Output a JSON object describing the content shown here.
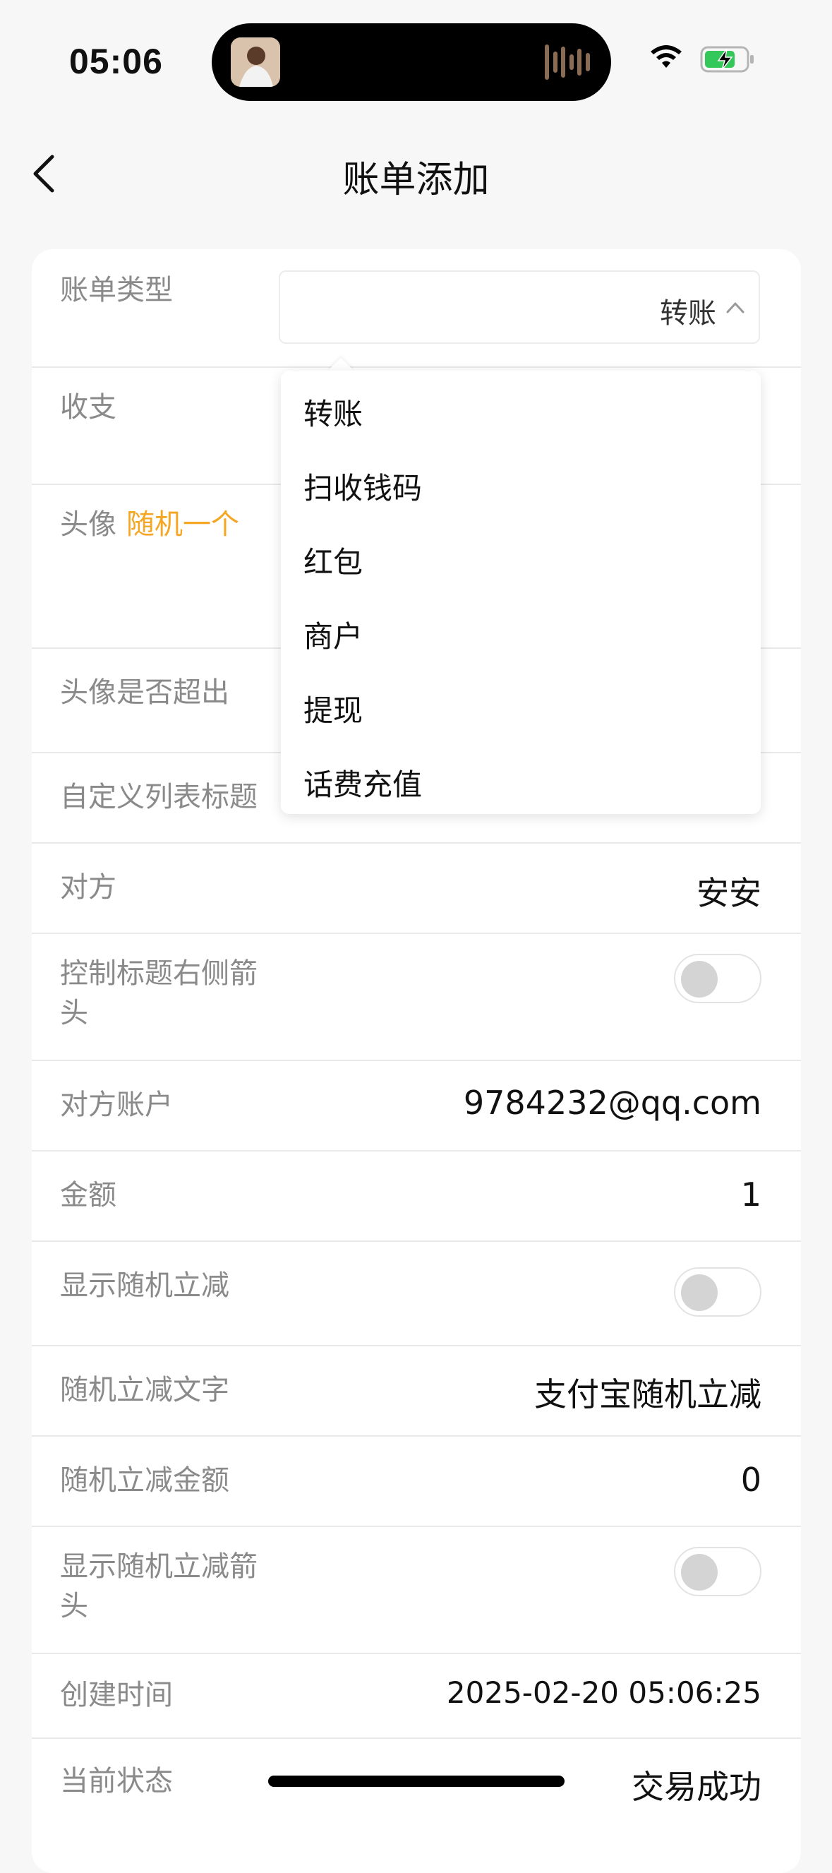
{
  "status": {
    "time": "05:06"
  },
  "nav": {
    "title": "账单添加"
  },
  "form": {
    "bill_type": {
      "label": "账单类型",
      "value": "转账"
    },
    "income_expense": {
      "label": "收支"
    },
    "avatar": {
      "label": "头像",
      "random_link": "随机一个"
    },
    "avatar_overflow": {
      "label": "头像是否超出"
    },
    "custom_list_title": {
      "label": "自定义列表标题"
    },
    "counterparty": {
      "label": "对方",
      "value": "安安"
    },
    "title_right_arrow": {
      "label_line1": "控制标题右侧箭",
      "label_line2": "头"
    },
    "counterparty_account": {
      "label": "对方账户",
      "value": "9784232@qq.com"
    },
    "amount": {
      "label": "金额",
      "value": "1"
    },
    "show_random_discount": {
      "label": "显示随机立减"
    },
    "random_discount_text": {
      "label": "随机立减文字",
      "value": "支付宝随机立减"
    },
    "random_discount_amount": {
      "label": "随机立减金额",
      "value": "0"
    },
    "show_random_discount_arrow": {
      "label_line1": "显示随机立减箭",
      "label_line2": "头"
    },
    "created_time": {
      "label": "创建时间",
      "value": "2025-02-20 05:06:25"
    },
    "current_status": {
      "label": "当前状态",
      "value": "交易成功"
    }
  },
  "dropdown": {
    "options": [
      "转账",
      "扫收钱码",
      "红包",
      "商户",
      "提现",
      "话费充值"
    ]
  },
  "colors": {
    "accent_orange": "#f5a623",
    "background": "#f7f7f7"
  }
}
